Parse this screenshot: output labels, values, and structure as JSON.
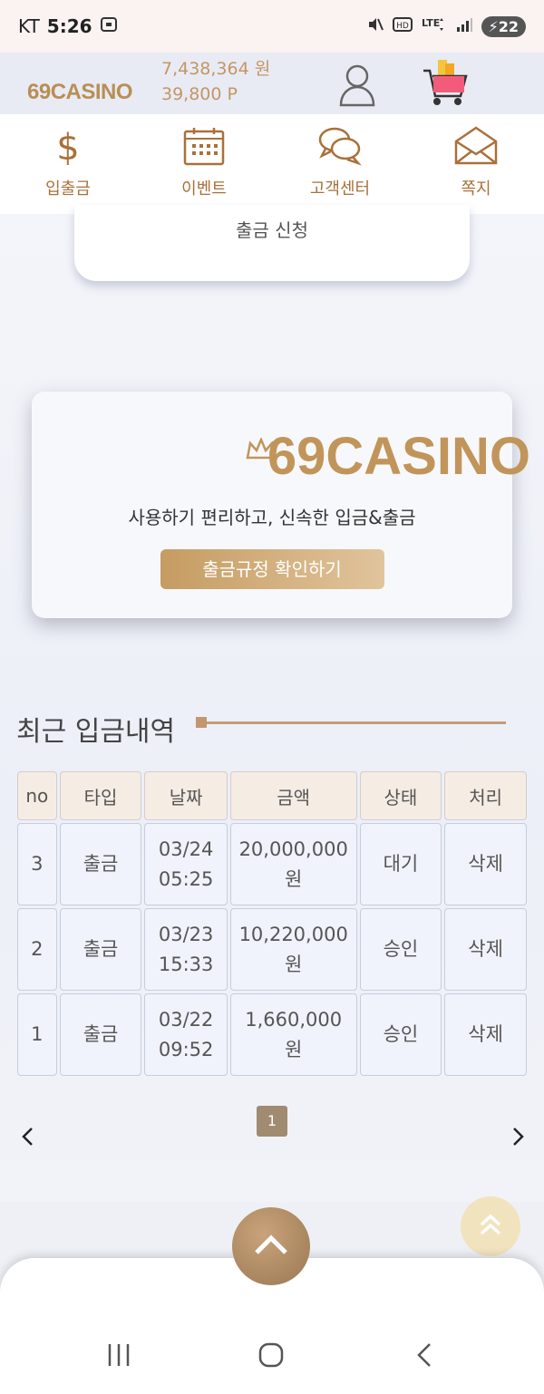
{
  "status": {
    "carrier": "KT",
    "time": "5:26",
    "battery": "22"
  },
  "header": {
    "logo": "69CASINO",
    "balance": "7,438,364 원",
    "points": "39,800 P"
  },
  "nav": [
    {
      "label": "입출금",
      "icon": "dollar-icon"
    },
    {
      "label": "이벤트",
      "icon": "calendar-icon"
    },
    {
      "label": "고객센터",
      "icon": "chat-icon"
    },
    {
      "label": "쪽지",
      "icon": "envelope-icon"
    }
  ],
  "withdraw_card": {
    "label": "출금 신청"
  },
  "promo": {
    "logo": "69CASINO",
    "tagline": "사용하기 편리하고, 신속한 입금&출금",
    "button": "출금규정 확인하기"
  },
  "history": {
    "title": "최근 입금내역",
    "columns": [
      "no",
      "타입",
      "날짜",
      "금액",
      "상태",
      "처리"
    ],
    "rows": [
      {
        "no": "3",
        "type": "출금",
        "date1": "03/24",
        "date2": "05:25",
        "amount1": "20,000,000",
        "amount2": "원",
        "status": "대기",
        "action": "삭제"
      },
      {
        "no": "2",
        "type": "출금",
        "date1": "03/23",
        "date2": "15:33",
        "amount1": "10,220,000",
        "amount2": "원",
        "status": "승인",
        "action": "삭제"
      },
      {
        "no": "1",
        "type": "출금",
        "date1": "03/22",
        "date2": "09:52",
        "amount1": "1,660,000",
        "amount2": "원",
        "status": "승인",
        "action": "삭제"
      }
    ]
  },
  "pagination": {
    "current": "1"
  },
  "colors": {
    "accent": "#c1955a",
    "nav_label": "#a9713a",
    "page_badge": "#a08a70"
  }
}
